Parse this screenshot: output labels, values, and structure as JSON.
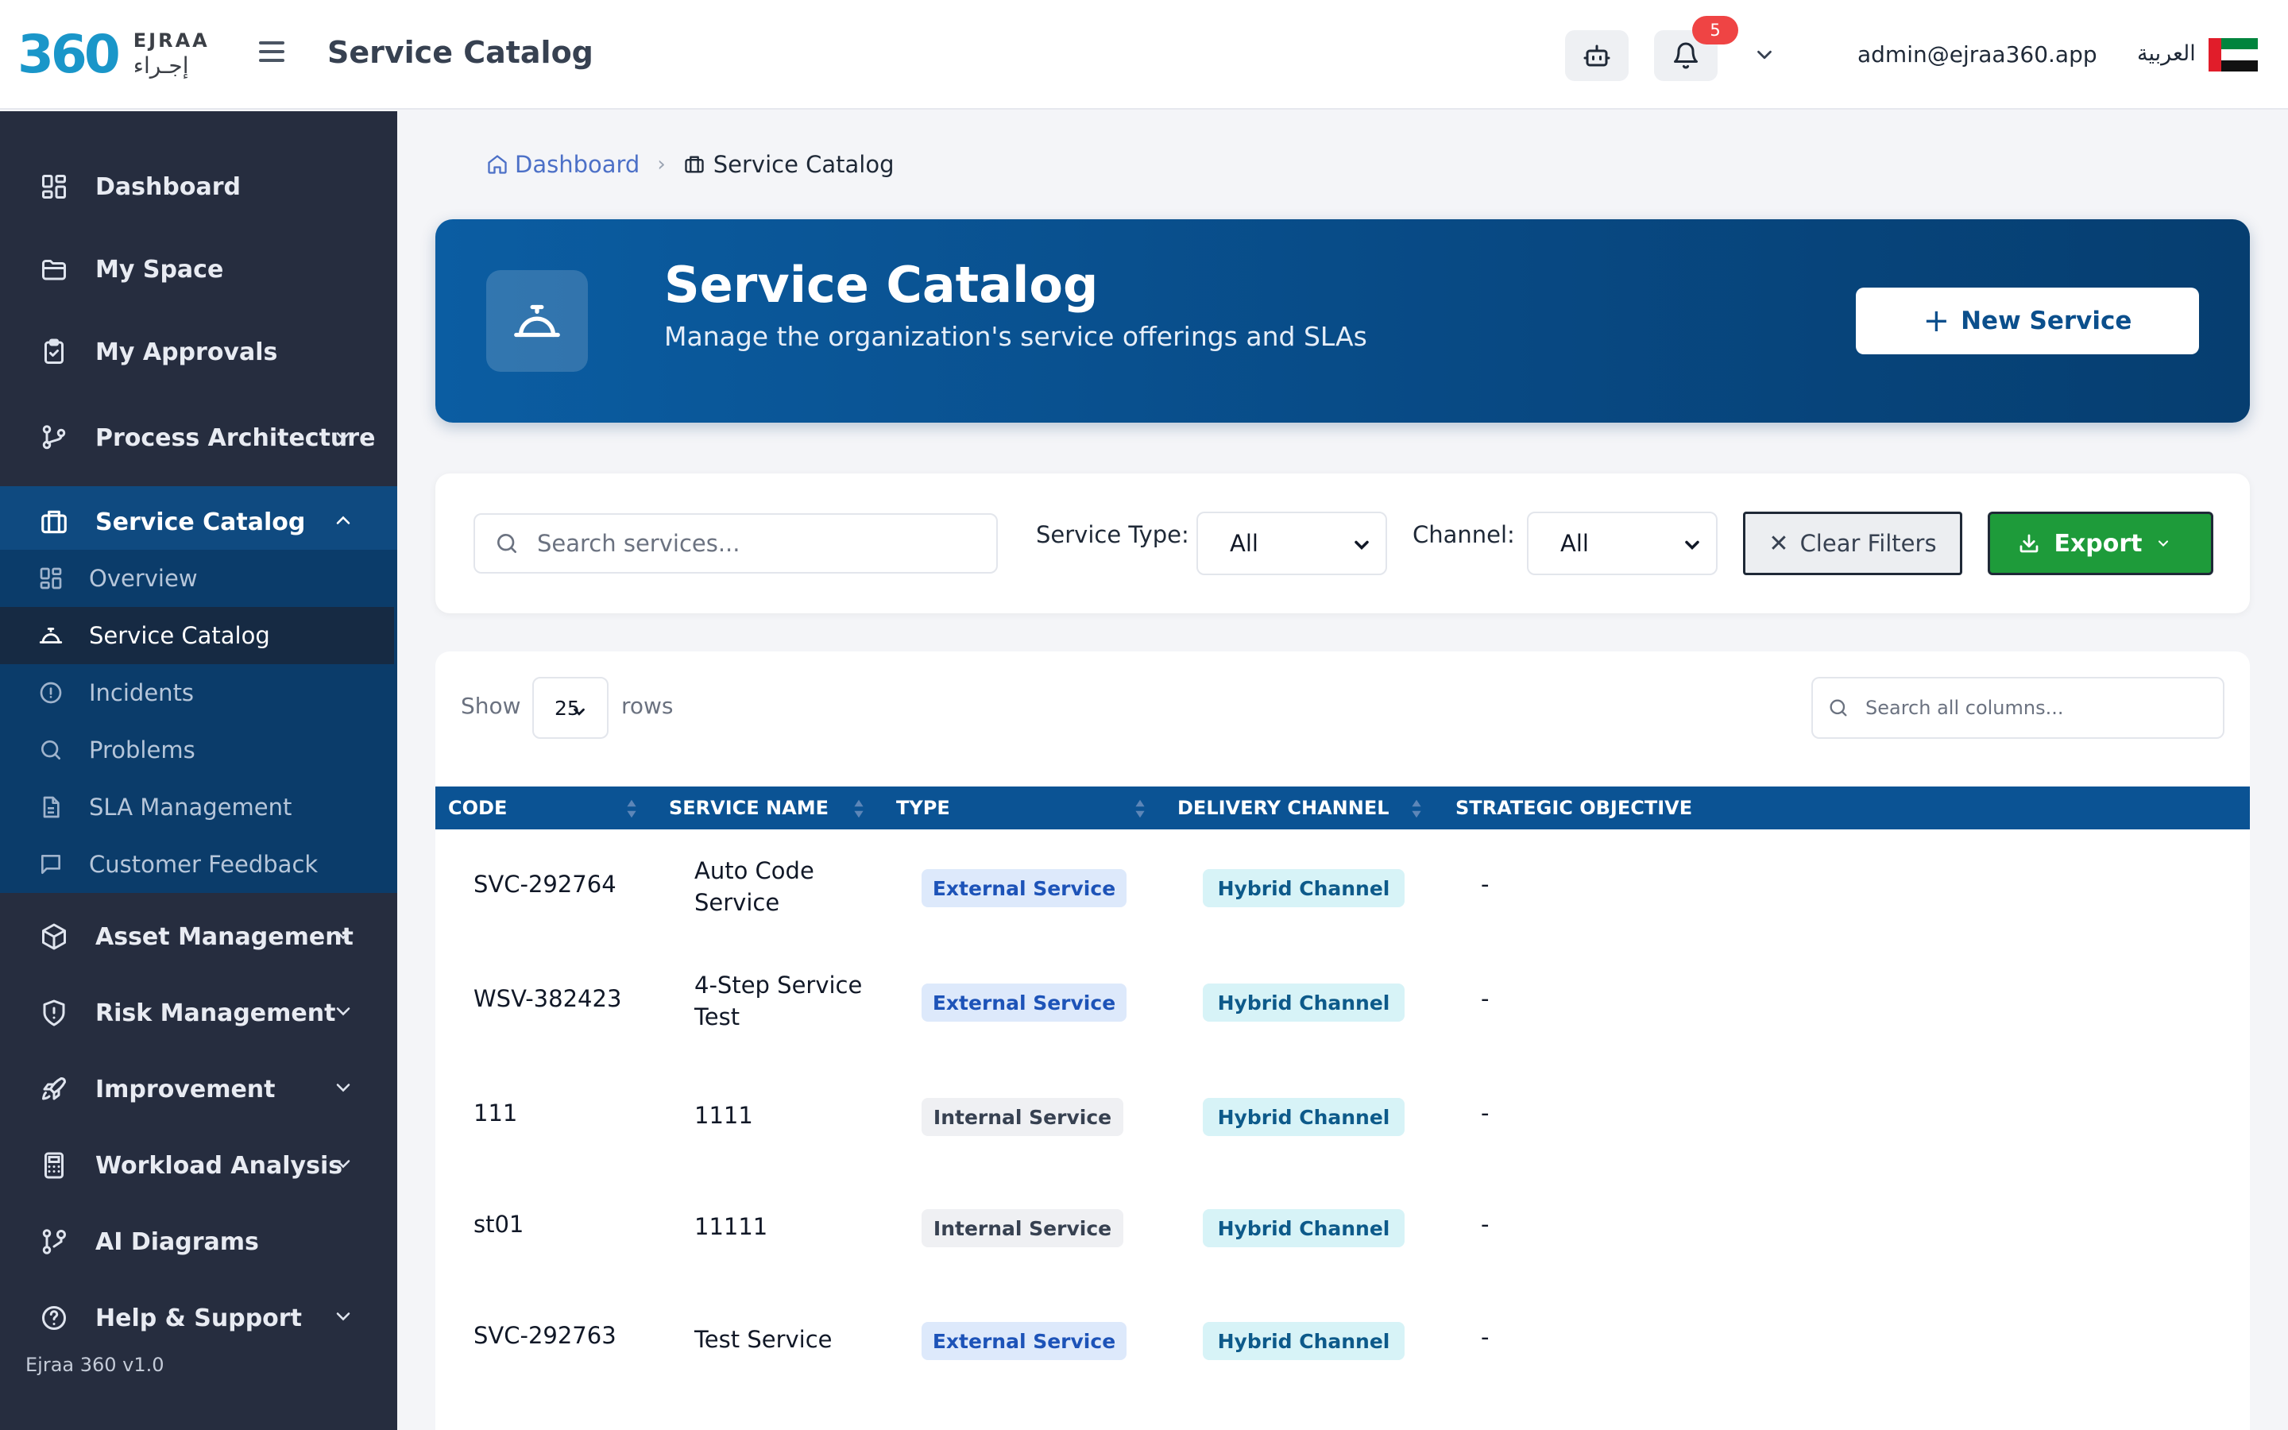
{
  "header": {
    "logo_number": "360",
    "logo_en": "EJRAA",
    "logo_ar": "إجـراء",
    "title": "Service Catalog",
    "notification_count": "5",
    "user_email": "admin@ejraa360.app",
    "language_toggle": "العربية"
  },
  "sidebar": {
    "items": [
      {
        "label": "Dashboard",
        "icon": "grid-icon"
      },
      {
        "label": "My Space",
        "icon": "folder-icon"
      },
      {
        "label": "My Approvals",
        "icon": "clipboard-check-icon"
      },
      {
        "label": "Process Architecture",
        "icon": "git-branch-icon"
      },
      {
        "label": "Service Catalog",
        "icon": "building-icon"
      },
      {
        "label": "Asset Management",
        "icon": "box-icon"
      },
      {
        "label": "Risk Management",
        "icon": "shield-alert-icon"
      },
      {
        "label": "Improvement",
        "icon": "rocket-icon"
      },
      {
        "label": "Workload Analysis",
        "icon": "calculator-icon"
      },
      {
        "label": "AI Diagrams",
        "icon": "diagram-icon"
      },
      {
        "label": "Help & Support",
        "icon": "help-circle-icon"
      }
    ],
    "sub_items": [
      {
        "label": "Overview",
        "icon": "grid-icon"
      },
      {
        "label": "Service Catalog",
        "icon": "bell-service-icon"
      },
      {
        "label": "Incidents",
        "icon": "alert-circle-icon"
      },
      {
        "label": "Problems",
        "icon": "search-icon"
      },
      {
        "label": "SLA Management",
        "icon": "document-icon"
      },
      {
        "label": "Customer Feedback",
        "icon": "message-square-icon"
      }
    ],
    "version": "Ejraa 360 v1.0"
  },
  "breadcrumb": {
    "home": "Dashboard",
    "current": "Service Catalog"
  },
  "hero": {
    "title": "Service Catalog",
    "subtitle": "Manage the organization's service offerings and SLAs",
    "new_button": "New Service"
  },
  "filters": {
    "search_placeholder": "Search services...",
    "service_type_label": "Service Type:",
    "service_type_value": "All",
    "channel_label": "Channel:",
    "channel_value": "All",
    "clear_label": "Clear Filters",
    "export_label": "Export"
  },
  "table": {
    "show_label": "Show",
    "rows_value": "25",
    "rows_label": "rows",
    "column_search_placeholder": "Search all columns...",
    "columns": [
      "CODE",
      "SERVICE NAME",
      "TYPE",
      "DELIVERY CHANNEL",
      "STRATEGIC OBJECTIVE"
    ],
    "rows": [
      {
        "code": "SVC-292764",
        "name": "Auto Code Service",
        "type": "External Service",
        "type_kind": "ext",
        "channel": "Hybrid Channel",
        "objective": "-"
      },
      {
        "code": "WSV-382423",
        "name": "4-Step Service Test",
        "type": "External Service",
        "type_kind": "ext",
        "channel": "Hybrid Channel",
        "objective": "-"
      },
      {
        "code": "111",
        "name": "1111",
        "type": "Internal Service",
        "type_kind": "int",
        "channel": "Hybrid Channel",
        "objective": "-"
      },
      {
        "code": "st01",
        "name": "11111",
        "type": "Internal Service",
        "type_kind": "int",
        "channel": "Hybrid Channel",
        "objective": "-"
      },
      {
        "code": "SVC-292763",
        "name": "Test Service",
        "type": "External Service",
        "type_kind": "ext",
        "channel": "Hybrid Channel",
        "objective": "-"
      }
    ]
  },
  "colors": {
    "sidebar_bg": "#262d3f",
    "sidebar_active": "#0f4a80",
    "hero_bg": "#084a85",
    "table_header": "#0b5394",
    "export_green": "#1e9b3a",
    "badge_red": "#ef4444"
  }
}
